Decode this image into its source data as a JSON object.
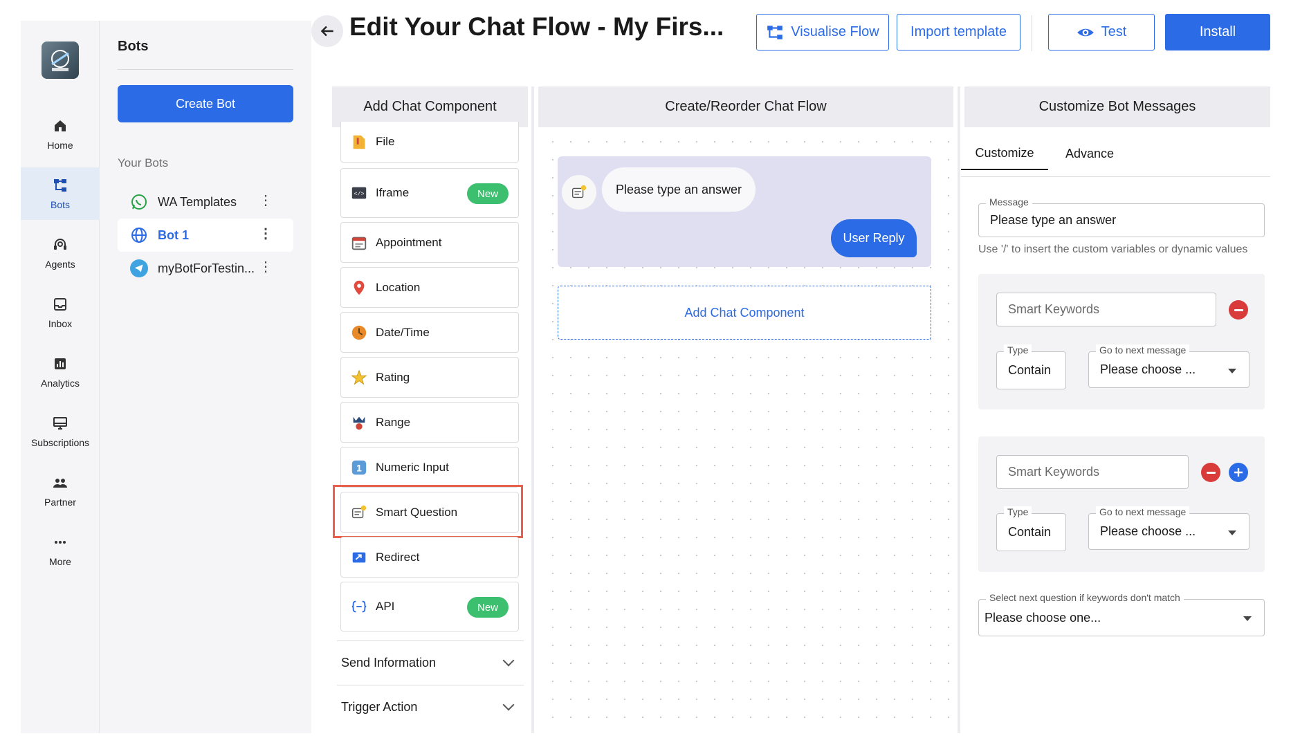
{
  "nav": {
    "items": [
      {
        "label": "Home",
        "icon": "home-icon"
      },
      {
        "label": "Bots",
        "icon": "bots-icon",
        "active": true
      },
      {
        "label": "Agents",
        "icon": "agents-icon"
      },
      {
        "label": "Inbox",
        "icon": "inbox-icon"
      },
      {
        "label": "Analytics",
        "icon": "analytics-icon"
      },
      {
        "label": "Subscriptions",
        "icon": "subscriptions-icon"
      },
      {
        "label": "Partner",
        "icon": "partner-icon"
      },
      {
        "label": "More",
        "icon": "more-icon"
      }
    ]
  },
  "bots_panel": {
    "title": "Bots",
    "create_label": "Create Bot",
    "section_label": "Your Bots",
    "bots": [
      {
        "name": "WA Templates",
        "icon": "whatsapp-icon"
      },
      {
        "name": "Bot 1",
        "icon": "globe-icon",
        "active": true
      },
      {
        "name": "myBotForTestin...",
        "icon": "telegram-icon"
      }
    ]
  },
  "header": {
    "title": "Edit Your Chat Flow - My Firs...",
    "visualise_label": "Visualise Flow",
    "import_label": "Import template",
    "test_label": "Test",
    "install_label": "Install"
  },
  "columns": {
    "components": "Add Chat Component",
    "flow": "Create/Reorder Chat Flow",
    "customize": "Customize Bot Messages"
  },
  "components": [
    {
      "label": "File",
      "icon": "file-icon"
    },
    {
      "label": "Iframe",
      "icon": "iframe-icon",
      "badge": "New"
    },
    {
      "label": "Appointment",
      "icon": "appointment-icon"
    },
    {
      "label": "Location",
      "icon": "location-icon"
    },
    {
      "label": "Date/Time",
      "icon": "clock-icon"
    },
    {
      "label": "Rating",
      "icon": "rating-icon"
    },
    {
      "label": "Range",
      "icon": "range-icon"
    },
    {
      "label": "Numeric Input",
      "icon": "numeric-icon"
    },
    {
      "label": "Smart Question",
      "icon": "smart-question-icon",
      "highlighted": true
    },
    {
      "label": "Redirect",
      "icon": "redirect-icon"
    },
    {
      "label": "API",
      "icon": "api-icon",
      "badge": "New"
    }
  ],
  "accordions": [
    {
      "label": "Send Information"
    },
    {
      "label": "Trigger Action"
    }
  ],
  "flow": {
    "bot_message": "Please type an answer",
    "user_reply": "User Reply",
    "add_component": "Add Chat Component"
  },
  "customize": {
    "tabs": [
      "Customize",
      "Advance"
    ],
    "message_label": "Message",
    "message_value": "Please type an answer",
    "hint": "Use '/' to insert the custom variables or dynamic values",
    "keywords_placeholder": "Smart Keywords",
    "type_label": "Type",
    "type_value": "Contain",
    "next_label": "Go to next message",
    "next_value": "Please choose ...",
    "fallback_label": "Select next question if keywords don't match",
    "fallback_value": "Please choose one..."
  },
  "colors": {
    "accent": "#2b6be6",
    "new_badge": "#3cbf6e",
    "highlight": "#e8604c",
    "remove": "#d93b3b"
  }
}
